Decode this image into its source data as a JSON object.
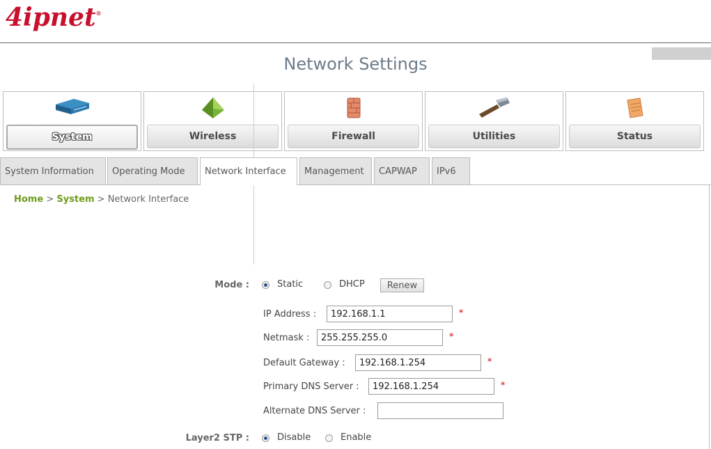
{
  "brand": {
    "logo_text": "4ipnet",
    "logo_mark": "®"
  },
  "nav": {
    "tiles": [
      {
        "label": "System",
        "icon": "switch-icon",
        "active": true
      },
      {
        "label": "Wireless",
        "icon": "antenna-icon",
        "active": false
      },
      {
        "label": "Firewall",
        "icon": "brick-wall-icon",
        "active": false
      },
      {
        "label": "Utilities",
        "icon": "hammer-icon",
        "active": false
      },
      {
        "label": "Status",
        "icon": "notepad-icon",
        "active": false
      }
    ]
  },
  "tabs": [
    {
      "label": "System Information",
      "active": false
    },
    {
      "label": "Operating Mode",
      "active": false
    },
    {
      "label": "Network Interface",
      "active": true
    },
    {
      "label": "Management",
      "active": false
    },
    {
      "label": "CAPWAP",
      "active": false
    },
    {
      "label": "IPv6",
      "active": false
    }
  ],
  "breadcrumb": {
    "home": "Home",
    "sep1": " > ",
    "section": "System",
    "sep2": " > ",
    "page": "Network Interface"
  },
  "page_title": "Network Settings",
  "form": {
    "mode": {
      "label": "Mode :",
      "options": [
        {
          "label": "Static",
          "selected": true
        },
        {
          "label": "DHCP",
          "selected": false
        }
      ],
      "renew_label": "Renew"
    },
    "fields": [
      {
        "label": "IP Address :",
        "value": "192.168.1.1",
        "required": true
      },
      {
        "label": "Netmask :",
        "value": "255.255.255.0",
        "required": true
      },
      {
        "label": "Default Gateway :",
        "value": "192.168.1.254",
        "required": true
      },
      {
        "label": "Primary DNS Server :",
        "value": "192.168.1.254",
        "required": true
      },
      {
        "label": "Alternate DNS Server :",
        "value": "",
        "required": false
      }
    ],
    "required_mark": "*",
    "stp": {
      "label": "Layer2 STP :",
      "options": [
        {
          "label": "Disable",
          "selected": true
        },
        {
          "label": "Enable",
          "selected": false
        }
      ]
    }
  },
  "colors": {
    "brand_red": "#c8102e",
    "breadcrumb_green": "#6e9a1a",
    "title_gray": "#6d7b8a",
    "required_red": "#e04040"
  }
}
